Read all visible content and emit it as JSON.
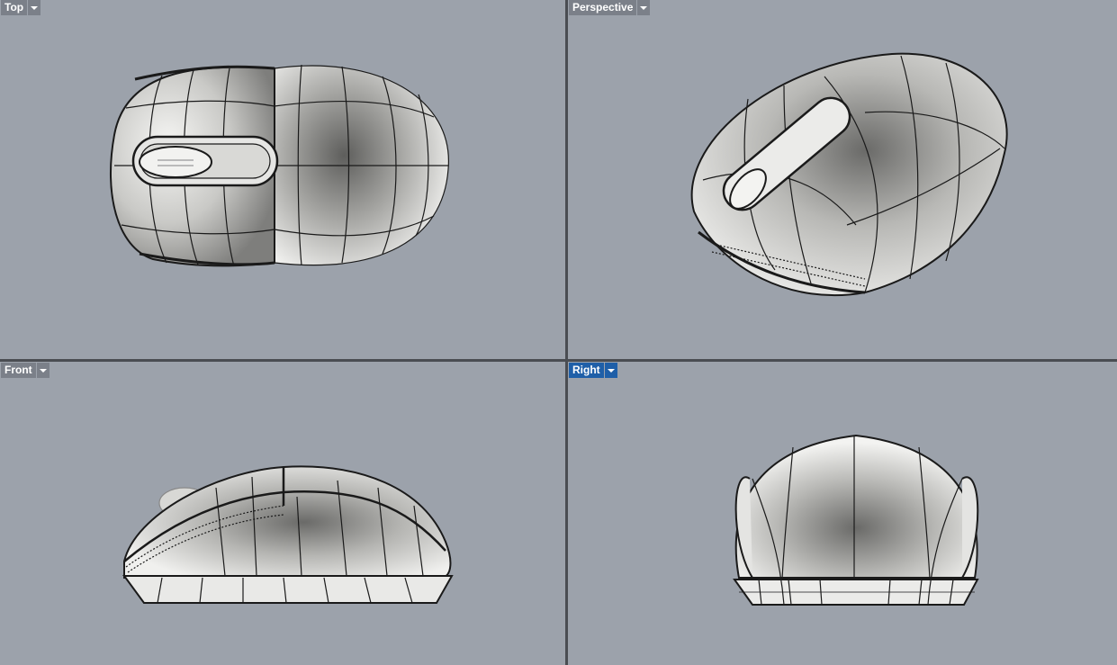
{
  "viewports": {
    "top": {
      "label": "Top",
      "active": false
    },
    "perspective": {
      "label": "Perspective",
      "active": false
    },
    "front": {
      "label": "Front",
      "active": false
    },
    "right": {
      "label": "Right",
      "active": true
    }
  },
  "colors": {
    "viewport_background": "#9ca2ab",
    "tab_background": "#7b8089",
    "active_tab_background": "#1f5fa8",
    "divider": "#4a4d52",
    "model_outline": "#1a1a1a"
  },
  "icons": {
    "viewport_menu": "chevron-down-icon"
  }
}
